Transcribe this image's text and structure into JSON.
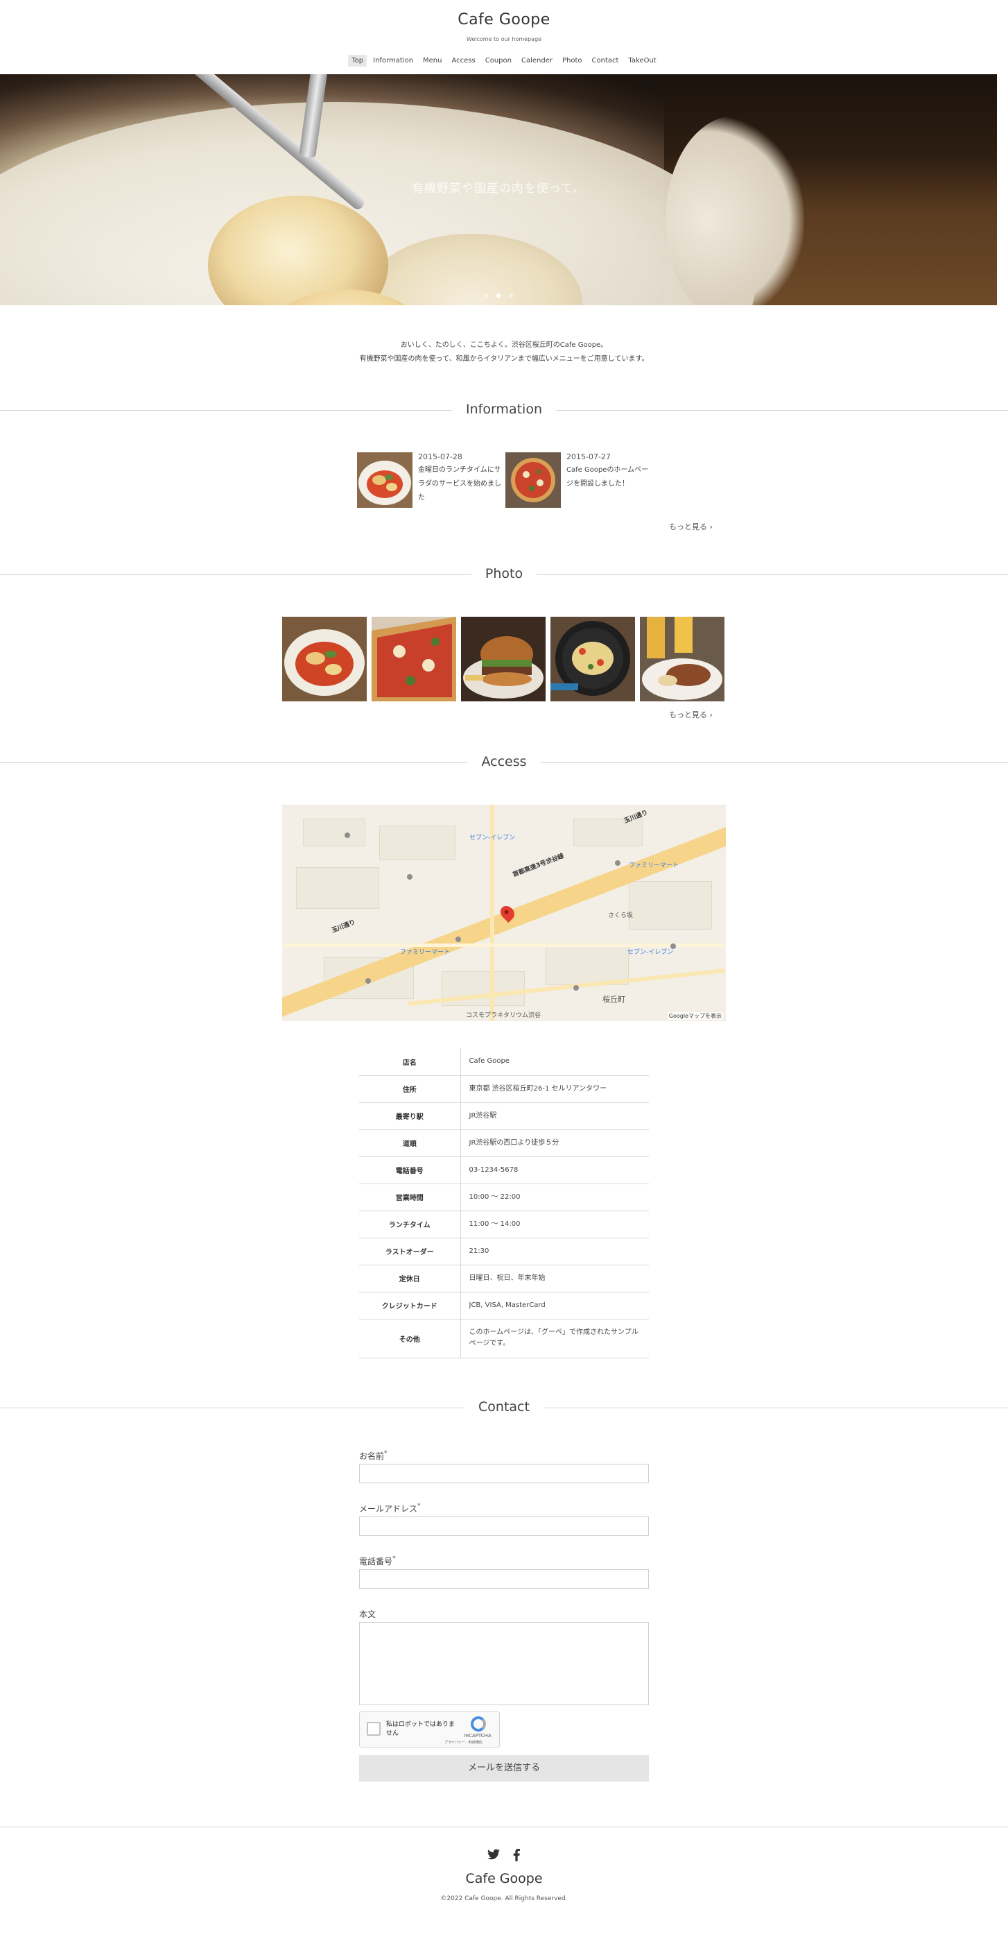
{
  "header": {
    "title": "Cafe Goope",
    "tagline": "Welcome to our homepage",
    "nav": [
      {
        "label": "Top",
        "active": true
      },
      {
        "label": "Information"
      },
      {
        "label": "Menu"
      },
      {
        "label": "Access"
      },
      {
        "label": "Coupon"
      },
      {
        "label": "Calender"
      },
      {
        "label": "Photo"
      },
      {
        "label": "Contact"
      },
      {
        "label": "TakeOut"
      }
    ]
  },
  "hero": {
    "caption": "有機野菜や国産の肉を使って、",
    "slide_count": 3,
    "active_slide": 2
  },
  "intro": {
    "line1": "おいしく、たのしく、ここちよく。渋谷区桜丘町のCafe Goope。",
    "line2": "有機野菜や国産の肉を使って、和風からイタリアンまで幅広いメニューをご用意しています。"
  },
  "sections": {
    "information": "Information",
    "photo": "Photo",
    "access": "Access",
    "contact": "Contact"
  },
  "information": {
    "items": [
      {
        "date": "2015-07-28",
        "text": "金曜日のランチタイムにサラダのサービスを始めました"
      },
      {
        "date": "2015-07-27",
        "text": "Cafe Goopeのホームページを開設しました！"
      }
    ],
    "more": "もっと見る ›"
  },
  "photo": {
    "more": "もっと見る ›"
  },
  "map": {
    "labels": {
      "road1": "玉川通り",
      "road2": "首都高速3号渋谷線",
      "road3": "玉川通り",
      "store1": "セブン-イレブン",
      "store2": "ファミリーマート",
      "store3": "さくら坂",
      "area": "桜丘町",
      "landmark": "コスモプラネタリウム渋谷",
      "footer": "Googleマップを表示"
    }
  },
  "access_table": [
    {
      "label": "店名",
      "value": "Cafe Goope"
    },
    {
      "label": "住所",
      "value": "東京都 渋谷区桜丘町26-1 セルリアンタワー"
    },
    {
      "label": "最寄り駅",
      "value": "JR渋谷駅"
    },
    {
      "label": "道順",
      "value": "JR渋谷駅の西口より徒歩５分"
    },
    {
      "label": "電話番号",
      "value": "03-1234-5678"
    },
    {
      "label": "営業時間",
      "value": "10:00 ～ 22:00"
    },
    {
      "label": "ランチタイム",
      "value": "11:00 ～ 14:00"
    },
    {
      "label": "ラストオーダー",
      "value": "21:30"
    },
    {
      "label": "定休日",
      "value": "日曜日、祝日、年末年始"
    },
    {
      "label": "クレジットカード",
      "value": "JCB, VISA, MasterCard"
    },
    {
      "label": "その他",
      "value": "このホームページは、「グーペ」で作成されたサンプルページです。"
    }
  ],
  "contact": {
    "name_label": "お名前",
    "email_label": "メールアドレス",
    "phone_label": "電話番号",
    "body_label": "本文",
    "required_mark": "*",
    "recaptcha_text": "私はロボットではありません",
    "recaptcha_brand": "reCAPTCHA",
    "recaptcha_privacy": "プライバシー - 利用規約",
    "submit_label": "メールを送信する"
  },
  "footer": {
    "title": "Cafe Goope",
    "copyright": "©2022 Cafe Goope. All Rights Reserved."
  }
}
